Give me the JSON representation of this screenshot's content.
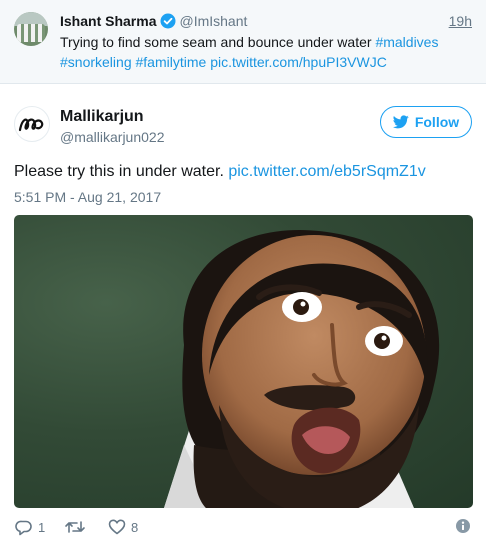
{
  "parent_tweet": {
    "name": "Ishant Sharma",
    "handle": "@ImIshant",
    "time": "19h",
    "text_plain": "Trying to find some seam and bounce under water ",
    "hashtag1": "#maldives",
    "hashtag2": "#snorkeling",
    "hashtag3": "#familytime",
    "pic_link": "pic.twitter.com/hpuPI3VWJC"
  },
  "tweet": {
    "name": "Mallikarjun",
    "handle": "@mallikarjun022",
    "follow_label": "Follow",
    "text": "Please try this in under water. ",
    "pic_link": "pic.twitter.com/eb5rSqmZ1v",
    "timestamp": "5:51 PM - Aug 21, 2017"
  },
  "actions": {
    "reply_count": "1",
    "retweet_count": "",
    "like_count": "8"
  },
  "colors": {
    "link": "#1b95e0",
    "follow": "#1da1f2",
    "muted": "#657786"
  }
}
